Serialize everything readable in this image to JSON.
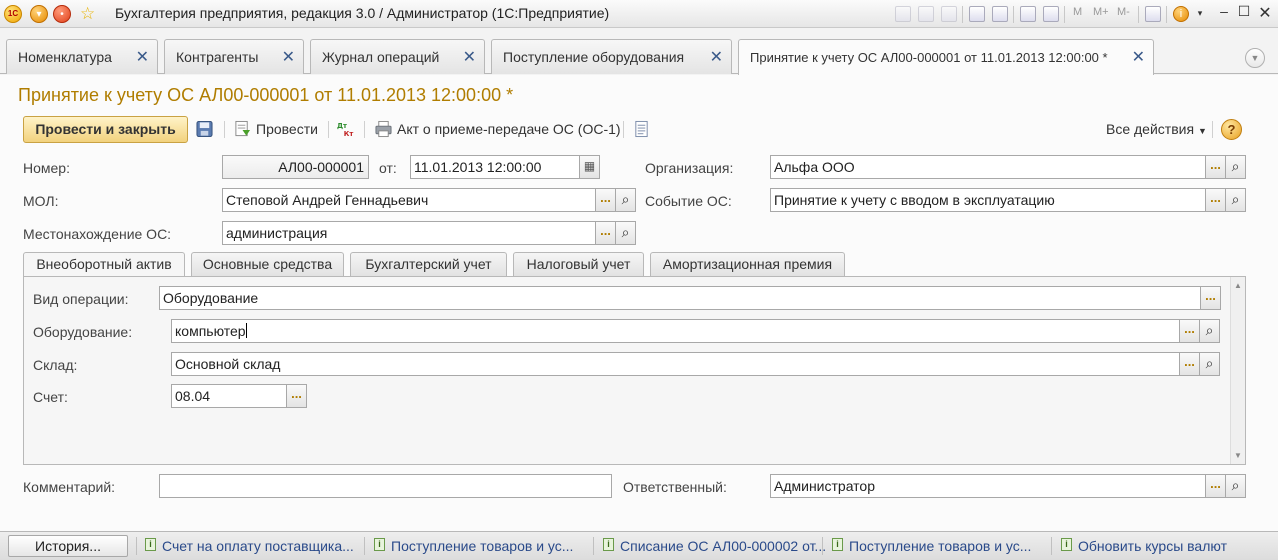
{
  "window": {
    "title": "Бухгалтерия предприятия, редакция 3.0 / Администратор  (1С:Предприятие)",
    "logo": "1С",
    "toolbar_letters": [
      "M",
      "M+",
      "M-"
    ]
  },
  "tabs": [
    {
      "label": "Номенклатура"
    },
    {
      "label": "Контрагенты"
    },
    {
      "label": "Журнал операций"
    },
    {
      "label": "Поступление оборудования"
    },
    {
      "label": "Принятие к учету ОС АЛ00-000001 от 11.01.2013 12:00:00 *"
    }
  ],
  "document": {
    "title": "Принятие к учету ОС АЛ00-000001 от 11.01.2013 12:00:00 *",
    "commands": {
      "post_and_close": "Провести и закрыть",
      "post": "Провести",
      "print_act": "Акт о приеме-передаче ОС (ОС-1)",
      "all_actions": "Все действия",
      "help": "?"
    },
    "header": {
      "number_label": "Номер:",
      "number_value": "АЛ00-000001",
      "date_label": "от:",
      "date_value": "11.01.2013 12:00:00",
      "org_label": "Организация:",
      "org_value": "Альфа ООО",
      "mol_label": "МОЛ:",
      "mol_value": "Степовой Андрей Геннадьевич",
      "event_label": "Событие ОС:",
      "event_value": "Принятие к учету с вводом в эксплуатацию",
      "location_label": "Местонахождение ОС:",
      "location_value": "администрация"
    },
    "inner_tabs": [
      {
        "label": "Внеоборотный актив"
      },
      {
        "label": "Основные средства"
      },
      {
        "label": "Бухгалтерский учет"
      },
      {
        "label": "Налоговый учет"
      },
      {
        "label": "Амортизационная премия"
      }
    ],
    "asset": {
      "operation_label": "Вид операции:",
      "operation_value": "Оборудование",
      "equipment_label": "Оборудование:",
      "equipment_value": "компьютер",
      "warehouse_label": "Склад:",
      "warehouse_value": "Основной склад",
      "account_label": "Счет:",
      "account_value": "08.04"
    },
    "footer": {
      "comment_label": "Комментарий:",
      "comment_value": "",
      "responsible_label": "Ответственный:",
      "responsible_value": "Администратор"
    }
  },
  "statusbar": {
    "history_label": "История...",
    "items": [
      {
        "label": "Счет на оплату поставщика..."
      },
      {
        "label": "Поступление товаров и ус..."
      },
      {
        "label": "Списание ОС АЛ00-000002 от..."
      },
      {
        "label": "Поступление товаров и ус..."
      },
      {
        "label": "Обновить курсы валют"
      }
    ]
  },
  "colors": {
    "accent_title": "#b07d00",
    "primary_button": "#f2d27e",
    "link": "#2a4a8a"
  }
}
